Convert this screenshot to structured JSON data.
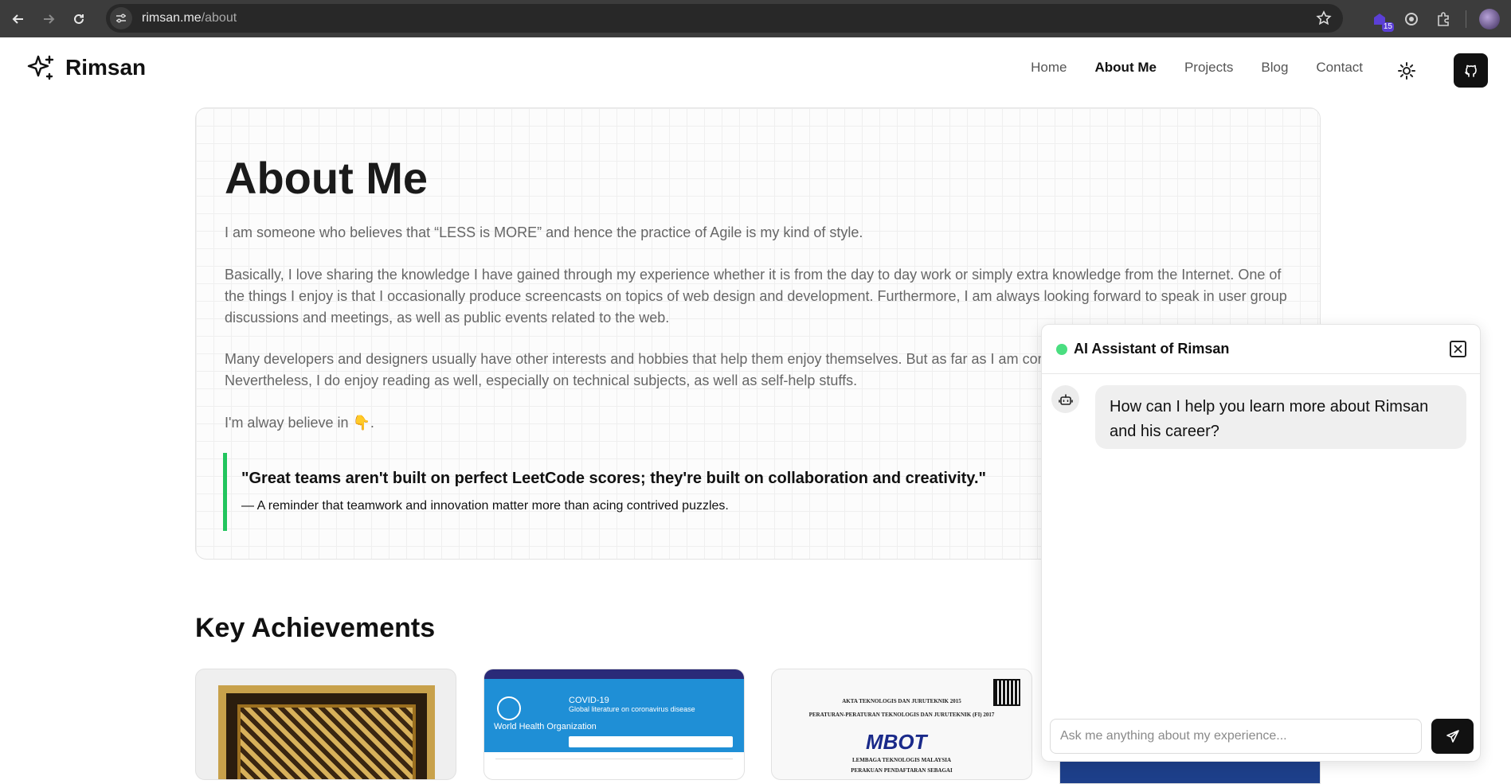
{
  "browser": {
    "url_host": "rimsan.me",
    "url_path": "/about",
    "extension_badge": "15"
  },
  "header": {
    "logo_text": "Rimsan",
    "nav": [
      {
        "label": "Home"
      },
      {
        "label": "About Me"
      },
      {
        "label": "Projects"
      },
      {
        "label": "Blog"
      },
      {
        "label": "Contact"
      }
    ]
  },
  "about": {
    "title": "About Me",
    "p1": "I am someone who believes that “LESS is MORE” and hence the practice of Agile is my kind of style.",
    "p2": "Basically, I love sharing the knowledge I have gained through my experience whether it is from the day to day work or simply extra knowledge from the Internet. One of the things I enjoy is that I occasionally produce screencasts on topics of web design and development. Furthermore, I am always looking forward to speak in user group discussions and meetings, as well as public events related to the web.",
    "p3": "Many developers and designers usually have other interests and hobbies that help them enjoy themselves. But as far as I am concerned, I don't have much. Nevertheless, I do enjoy reading as well, especially on technical subjects, as well as self-help stuffs.",
    "p4": "I'm alway believe in 👇.",
    "quote": "\"Great teams aren't built on perfect LeetCode scores; they're built on collaboration and creativity.\"",
    "quote_sub": "— A reminder that teamwork and innovation matter more than acing contrived puzzles."
  },
  "achievements": {
    "title": "Key Achievements",
    "card2": {
      "org": "World Health Organization",
      "heading": "COVID-19",
      "subheading": "Global literature on coronavirus disease"
    },
    "card3": {
      "line1": "AKTA TEKNOLOGIS DAN JURUTEKNIK 2015",
      "line2": "PERATURAN-PERATURAN TEKNOLOGIS DAN JURUTEKNIK (FI) 2017",
      "logo": "MBOT",
      "line3": "LEMBAGA TEKNOLOGIS MALAYSIA",
      "line4": "PERAKUAN PENDAFTARAN SEBAGAI"
    }
  },
  "chat": {
    "title": "AI Assistant of Rimsan",
    "bot_message": "How can I help you learn more about Rimsan and his career?",
    "input_placeholder": "Ask me anything about my experience...",
    "status_color": "#4ade80"
  },
  "colors": {
    "quote_accent": "#22c55e",
    "chrome_bg": "#3c3c3c"
  }
}
